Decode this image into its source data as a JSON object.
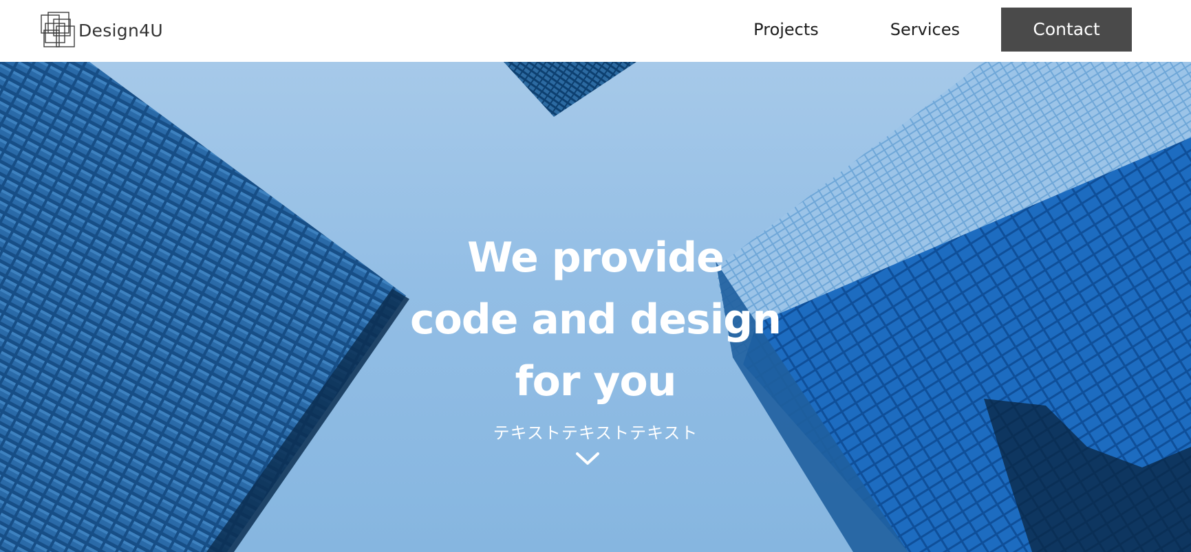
{
  "header": {
    "logo_text": "Design4U",
    "nav": {
      "projects": "Projects",
      "services": "Services",
      "contact": "Contact"
    }
  },
  "hero": {
    "title_lines": [
      "We provide",
      "code and design",
      "for you"
    ],
    "subtitle": "テキストテキストテキスト",
    "scroll_icon": "chevron-down-icon"
  },
  "colors": {
    "header_bg": "#ffffff",
    "contact_button_bg": "#4a4a4a",
    "hero_sky": "#93bee5",
    "building_dark": "#0f3a66",
    "building_bright": "#1f6fb8",
    "hero_text": "#ffffff"
  }
}
